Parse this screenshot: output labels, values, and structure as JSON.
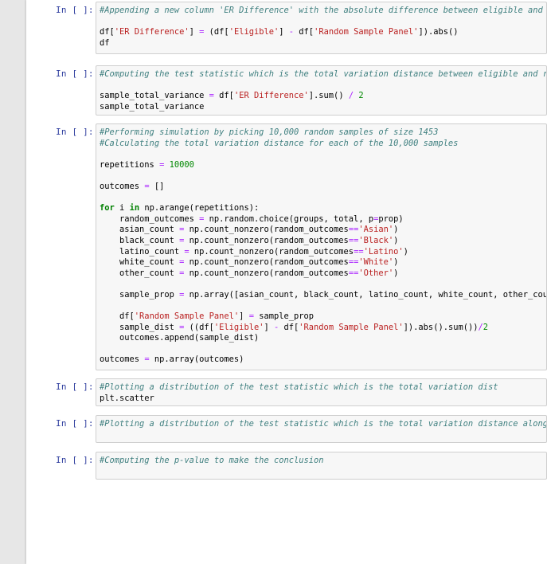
{
  "notebook": {
    "cells": [
      {
        "prompt": "In [ ]:",
        "lines": [
          [
            {
              "c": "cm",
              "t": "#Appending a new column 'ER Difference' with the absolute difference between eligible and r"
            }
          ],
          [],
          [
            {
              "c": "",
              "t": "df["
            },
            {
              "c": "st",
              "t": "'ER Difference'"
            },
            {
              "c": "",
              "t": "] "
            },
            {
              "c": "op",
              "t": "="
            },
            {
              "c": "",
              "t": " (df["
            },
            {
              "c": "st",
              "t": "'Eligible'"
            },
            {
              "c": "",
              "t": "] "
            },
            {
              "c": "op",
              "t": "-"
            },
            {
              "c": "",
              "t": " df["
            },
            {
              "c": "st",
              "t": "'Random Sample Panel'"
            },
            {
              "c": "",
              "t": "]).abs()"
            }
          ],
          [
            {
              "c": "",
              "t": "df"
            }
          ]
        ]
      },
      {
        "prompt": "In [ ]:",
        "lines": [
          [
            {
              "c": "cm",
              "t": "#Computing the test statistic which is the total variation distance between eligible and ra"
            }
          ],
          [],
          [
            {
              "c": "",
              "t": "sample_total_variance "
            },
            {
              "c": "op",
              "t": "="
            },
            {
              "c": "",
              "t": " df["
            },
            {
              "c": "st",
              "t": "'ER Difference'"
            },
            {
              "c": "",
              "t": "].sum() "
            },
            {
              "c": "op",
              "t": "/"
            },
            {
              "c": "",
              "t": " "
            },
            {
              "c": "nu",
              "t": "2"
            }
          ],
          [
            {
              "c": "",
              "t": "sample_total_variance"
            }
          ]
        ]
      },
      {
        "prompt": "In [ ]:",
        "lines": [
          [
            {
              "c": "cm",
              "t": "#Performing simulation by picking 10,000 random samples of size 1453"
            }
          ],
          [
            {
              "c": "cm",
              "t": "#Calculating the total variation distance for each of the 10,000 samples"
            }
          ],
          [],
          [
            {
              "c": "",
              "t": "repetitions "
            },
            {
              "c": "op",
              "t": "="
            },
            {
              "c": "",
              "t": " "
            },
            {
              "c": "nu",
              "t": "10000"
            }
          ],
          [],
          [
            {
              "c": "",
              "t": "outcomes "
            },
            {
              "c": "op",
              "t": "="
            },
            {
              "c": "",
              "t": " []"
            }
          ],
          [],
          [
            {
              "c": "kw",
              "t": "for"
            },
            {
              "c": "",
              "t": " i "
            },
            {
              "c": "kw",
              "t": "in"
            },
            {
              "c": "",
              "t": " np.arange(repetitions):"
            }
          ],
          [
            {
              "c": "",
              "t": "    random_outcomes "
            },
            {
              "c": "op",
              "t": "="
            },
            {
              "c": "",
              "t": " np.random.choice(groups, total, p"
            },
            {
              "c": "op",
              "t": "="
            },
            {
              "c": "",
              "t": "prop)"
            }
          ],
          [
            {
              "c": "",
              "t": "    asian_count "
            },
            {
              "c": "op",
              "t": "="
            },
            {
              "c": "",
              "t": " np.count_nonzero(random_outcomes"
            },
            {
              "c": "op",
              "t": "=="
            },
            {
              "c": "st",
              "t": "'Asian'"
            },
            {
              "c": "",
              "t": ")"
            }
          ],
          [
            {
              "c": "",
              "t": "    black_count "
            },
            {
              "c": "op",
              "t": "="
            },
            {
              "c": "",
              "t": " np.count_nonzero(random_outcomes"
            },
            {
              "c": "op",
              "t": "=="
            },
            {
              "c": "st",
              "t": "'Black'"
            },
            {
              "c": "",
              "t": ")"
            }
          ],
          [
            {
              "c": "",
              "t": "    latino_count "
            },
            {
              "c": "op",
              "t": "="
            },
            {
              "c": "",
              "t": " np.count_nonzero(random_outcomes"
            },
            {
              "c": "op",
              "t": "=="
            },
            {
              "c": "st",
              "t": "'Latino'"
            },
            {
              "c": "",
              "t": ")"
            }
          ],
          [
            {
              "c": "",
              "t": "    white_count "
            },
            {
              "c": "op",
              "t": "="
            },
            {
              "c": "",
              "t": " np.count_nonzero(random_outcomes"
            },
            {
              "c": "op",
              "t": "=="
            },
            {
              "c": "st",
              "t": "'White'"
            },
            {
              "c": "",
              "t": ")"
            }
          ],
          [
            {
              "c": "",
              "t": "    other_count "
            },
            {
              "c": "op",
              "t": "="
            },
            {
              "c": "",
              "t": " np.count_nonzero(random_outcomes"
            },
            {
              "c": "op",
              "t": "=="
            },
            {
              "c": "st",
              "t": "'Other'"
            },
            {
              "c": "",
              "t": ")"
            }
          ],
          [],
          [
            {
              "c": "",
              "t": "    sample_prop "
            },
            {
              "c": "op",
              "t": "="
            },
            {
              "c": "",
              "t": " np.array([asian_count, black_count, latino_count, white_count, other_coun"
            }
          ],
          [],
          [
            {
              "c": "",
              "t": "    df["
            },
            {
              "c": "st",
              "t": "'Random Sample Panel'"
            },
            {
              "c": "",
              "t": "] "
            },
            {
              "c": "op",
              "t": "="
            },
            {
              "c": "",
              "t": " sample_prop"
            }
          ],
          [
            {
              "c": "",
              "t": "    sample_dist "
            },
            {
              "c": "op",
              "t": "="
            },
            {
              "c": "",
              "t": " ((df["
            },
            {
              "c": "st",
              "t": "'Eligible'"
            },
            {
              "c": "",
              "t": "] "
            },
            {
              "c": "op",
              "t": "-"
            },
            {
              "c": "",
              "t": " df["
            },
            {
              "c": "st",
              "t": "'Random Sample Panel'"
            },
            {
              "c": "",
              "t": "]).abs().sum())"
            },
            {
              "c": "op",
              "t": "/"
            },
            {
              "c": "nu",
              "t": "2"
            }
          ],
          [
            {
              "c": "",
              "t": "    outcomes.append(sample_dist)"
            }
          ],
          [],
          [
            {
              "c": "",
              "t": "outcomes "
            },
            {
              "c": "op",
              "t": "="
            },
            {
              "c": "",
              "t": " np.array(outcomes)"
            }
          ]
        ]
      },
      {
        "prompt": "In [ ]:",
        "lines": [
          [
            {
              "c": "cm",
              "t": "#Plotting a distribution of the test statistic which is the total variation dist"
            }
          ],
          [
            {
              "c": "",
              "t": "plt.scatter"
            }
          ]
        ]
      },
      {
        "prompt": "In [ ]:",
        "lines": [
          [
            {
              "c": "cm",
              "t": "#Plotting a distribution of the test statistic which is the total variation distance along"
            }
          ],
          []
        ]
      },
      {
        "prompt": "In [ ]:",
        "lines": [
          [
            {
              "c": "cm",
              "t": "#Computing the p-value to make the conclusion"
            }
          ],
          []
        ]
      }
    ]
  }
}
